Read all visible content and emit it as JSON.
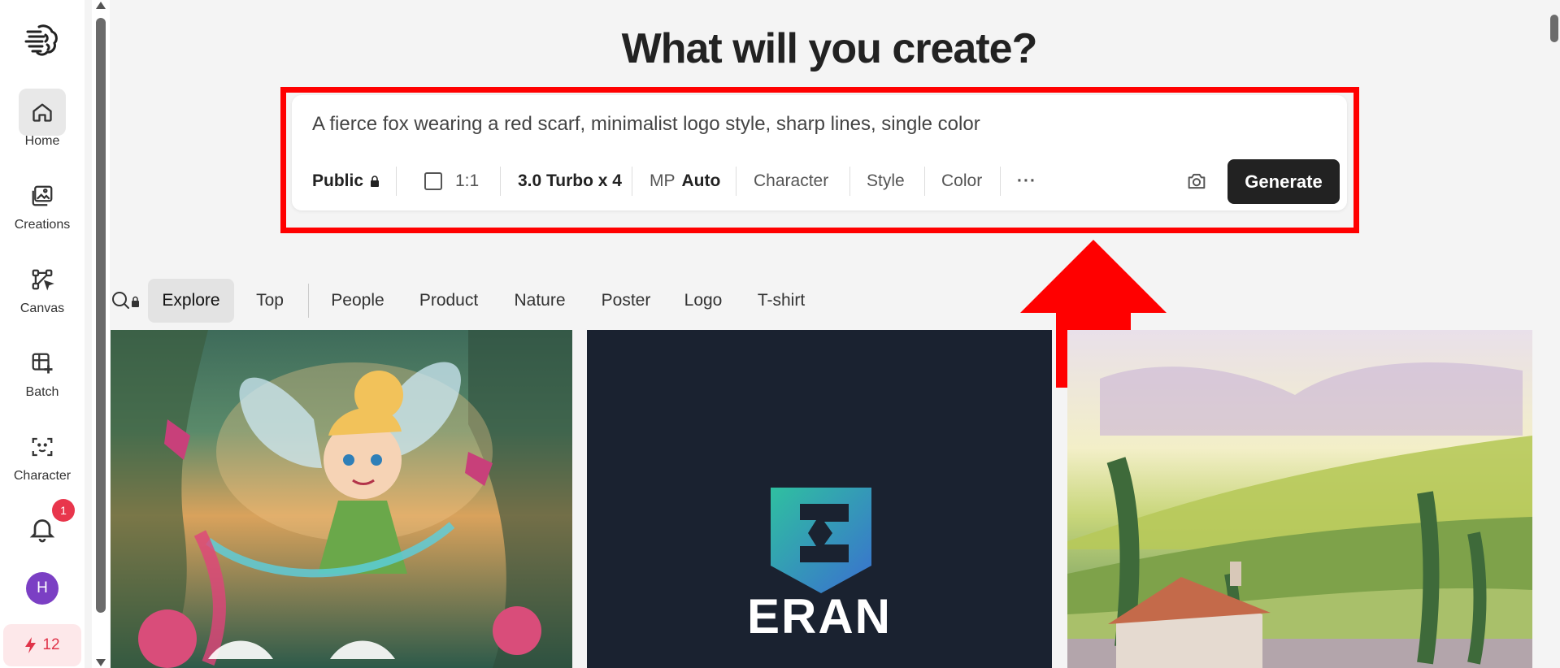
{
  "sidebar": {
    "items": [
      {
        "label": "Home",
        "icon": "home-icon"
      },
      {
        "label": "Creations",
        "icon": "image-icon"
      },
      {
        "label": "Canvas",
        "icon": "canvas-icon"
      },
      {
        "label": "Batch",
        "icon": "batch-icon"
      },
      {
        "label": "Character",
        "icon": "character-icon"
      }
    ],
    "notification_count": "1",
    "avatar_initial": "H",
    "credits": "12"
  },
  "main": {
    "title": "What will you create?",
    "prompt": "A fierce fox wearing a red scarf, minimalist logo style, sharp lines, single color",
    "toolbar": {
      "visibility": "Public",
      "aspect_ratio": "1:1",
      "model": "3.0 Turbo x 4",
      "mp_label": "MP",
      "mp_value": "Auto",
      "character": "Character",
      "style": "Style",
      "color": "Color",
      "more": "···",
      "generate": "Generate"
    },
    "filters": [
      "Explore",
      "Top",
      "People",
      "Product",
      "Nature",
      "Poster",
      "Logo",
      "T-shirt"
    ],
    "active_filter": "Explore",
    "gallery": [
      {
        "subject": "fairy illustration"
      },
      {
        "subject": "logo",
        "text": "ERAN"
      },
      {
        "subject": "watercolor landscape"
      }
    ]
  },
  "colors": {
    "accent_red": "#ff0000",
    "generate_bg": "#222222",
    "badge": "#e8364c",
    "avatar": "#7b3fc4"
  }
}
